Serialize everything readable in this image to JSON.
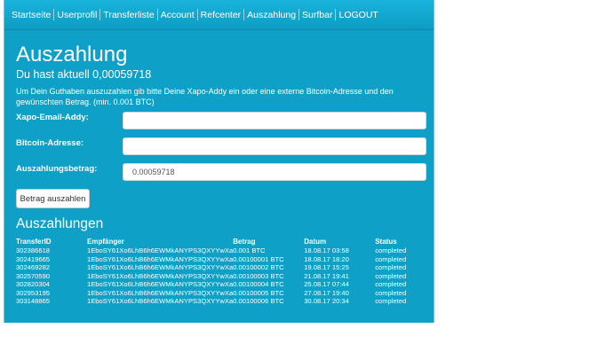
{
  "nav": {
    "items": [
      "Startseite",
      "Userprofil",
      "Transferliste",
      "Account",
      "Refcenter",
      "Auszahlung",
      "Surfbar",
      "LOGOUT"
    ]
  },
  "page": {
    "title": "Auszahlung",
    "balance": "Du hast aktuell 0,00059718",
    "intro": "Um Dein Guthaben auszuzahlen gib bitte Deine Xapo-Addy ein oder eine externe Bitcoin-Adresse und den gewünschten Betrag. (min. 0.001 BTC)"
  },
  "form": {
    "xapo_label": "Xapo-Email-Addy:",
    "xapo_value": "",
    "bitcoin_label": "Bitcoin-Adresse:",
    "bitcoin_value": "",
    "amount_label": "Auszahlungsbetrag:",
    "amount_value": "0.00059718",
    "submit_label": "Betrag auszahlen"
  },
  "payouts": {
    "title": "Auszahlungen",
    "columns": [
      "TransferID",
      "Empfänger",
      "Betrag",
      "Datum",
      "Status"
    ],
    "rows": [
      [
        "302386618",
        "1EboSY61Xo6LhB6h6EWMkANYPS3QXYYwXa",
        "0.001 BTC",
        "18.08.17 03:58",
        "completed"
      ],
      [
        "302419665",
        "1EboSY61Xo6LhB6h6EWMkANYPS3QXYYwXa",
        "0.00100001 BTC",
        "18.08.17 18:20",
        "completed"
      ],
      [
        "302469282",
        "1EboSY61Xo6LhB6h6EWMkANYPS3QXYYwXa",
        "0.00100002 BTC",
        "19.08.17 15:25",
        "completed"
      ],
      [
        "302570590",
        "1EboSY61Xo6LhB6h6EWMkANYPS3QXYYwXa",
        "0.00100003 BTC",
        "21.08.17 19:41",
        "completed"
      ],
      [
        "302820304",
        "1EboSY61Xo6LhB6h6EWMkANYPS3QXYYwXa",
        "0.00100004 BTC",
        "25.08.17 07:44",
        "completed"
      ],
      [
        "302953195",
        "1EboSY61Xo6LhB6h6EWMkANYPS3QXYYwXa",
        "0.00100005 BTC",
        "27.08.17 19:40",
        "completed"
      ],
      [
        "303148865",
        "1EboSY61Xo6LhB6h6EWMkANYPS3QXYYwXa",
        "0.00100006 BTC",
        "30.08.17 20:34",
        "completed"
      ]
    ]
  }
}
